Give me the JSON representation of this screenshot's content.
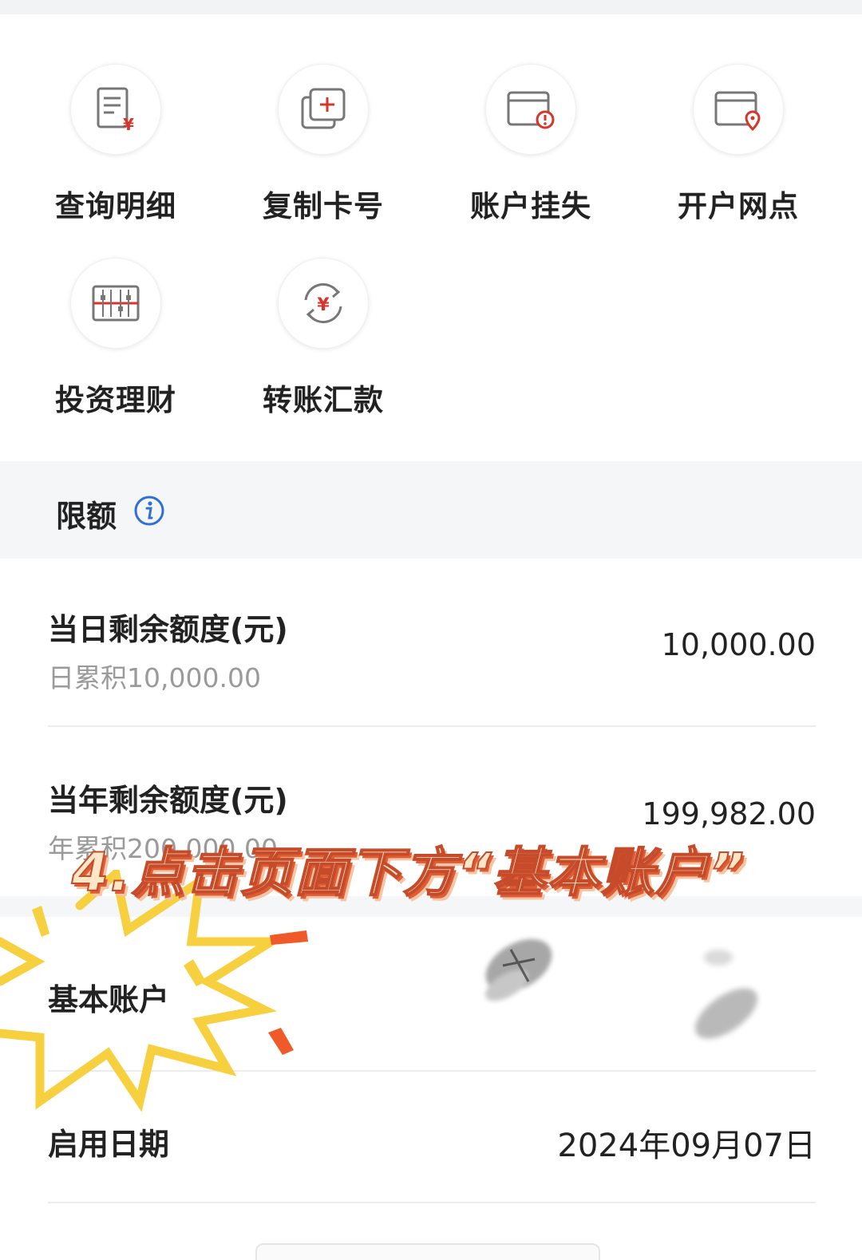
{
  "actions": [
    {
      "label": "查询明细",
      "icon": "statement-icon"
    },
    {
      "label": "复制卡号",
      "icon": "copy-card-icon"
    },
    {
      "label": "账户挂失",
      "icon": "report-loss-icon"
    },
    {
      "label": "开户网点",
      "icon": "branch-location-icon"
    },
    {
      "label": "投资理财",
      "icon": "investment-icon"
    },
    {
      "label": "转账汇款",
      "icon": "transfer-icon"
    }
  ],
  "limits": {
    "title": "限额",
    "daily": {
      "label": "当日剩余额度(元)",
      "sub": "日累积10,000.00",
      "value": "10,000.00"
    },
    "yearly": {
      "label": "当年剩余额度(元)",
      "sub": "年累积200,000.00",
      "value": "199,982.00"
    }
  },
  "account": {
    "basic_label": "基本账户",
    "date_label": "启用日期",
    "date_value": "2024年09月07日"
  },
  "annotation": {
    "caption": "4.点击页面下方“基本账户”"
  },
  "colors": {
    "accent_red": "#d9342b",
    "info_blue": "#2f6fd6",
    "burst_yellow": "#f6d03e",
    "burst_orange": "#f05a28"
  }
}
